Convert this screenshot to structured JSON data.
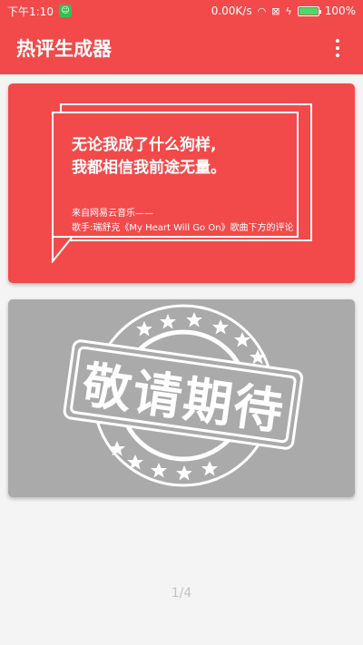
{
  "status_bar": {
    "time": "下午1:10",
    "speed": "0.00K/s",
    "battery": "100%",
    "icons": [
      "wechat-icon",
      "wifi-icon",
      "sim-icon",
      "charging-icon",
      "battery-icon"
    ]
  },
  "app_bar": {
    "title": "热评生成器",
    "menu_icon": "more-vert-icon"
  },
  "cards": [
    {
      "quote_lines": [
        "无论我成了什么狗样,",
        "我都相信我前途无量。"
      ],
      "source_lines": [
        "来自网易云音乐——",
        "歌手:瑞舒克《My Heart Will Go On》歌曲下方的评论"
      ]
    },
    {
      "stamp_text": "敬请期待"
    }
  ],
  "pager": {
    "indicator": "1/4"
  },
  "colors": {
    "primary": "#f24a4a",
    "coming_soon_card": "#aaaaaa",
    "background": "#f4f4f4",
    "indicator": "#c2c2c2"
  }
}
